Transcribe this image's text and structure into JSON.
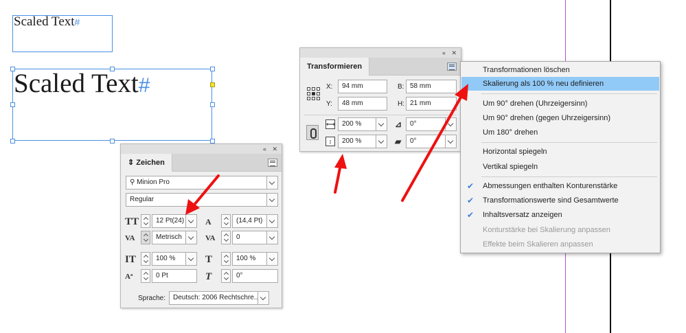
{
  "canvas": {
    "text_small": "Scaled Text",
    "text_large": "Scaled Text",
    "end_marker": "#"
  },
  "zeichen": {
    "tab_label": "Zeichen",
    "font_family": "Minion Pro",
    "font_style": "Regular",
    "font_size": "12 Pt(24)",
    "leading": "(14,4 Pt)",
    "kerning": "Metrisch",
    "tracking": "0",
    "vertical_scale": "100 %",
    "horizontal_scale": "100 %",
    "baseline_shift": "0 Pt",
    "skew": "0°",
    "language_label": "Sprache:",
    "language": "Deutsch: 2006 Rechtschre..."
  },
  "transformieren": {
    "tab_label": "Transformieren",
    "x_label": "X:",
    "x_value": "94 mm",
    "y_label": "Y:",
    "y_value": "48 mm",
    "b_label": "B:",
    "b_value": "58 mm",
    "h_label": "H:",
    "h_value": "21 mm",
    "scale_x": "200 %",
    "scale_y": "200 %",
    "rotation": "0°",
    "shear": "0°"
  },
  "context_menu": {
    "items": [
      {
        "label": "Transformationen löschen",
        "checked": false,
        "disabled": false,
        "highlight": false
      },
      {
        "label": "Skalierung als 100 % neu definieren",
        "checked": false,
        "disabled": false,
        "highlight": true
      },
      {
        "label": "Um 90° drehen (Uhrzeigersinn)",
        "checked": false,
        "disabled": false,
        "highlight": false
      },
      {
        "label": "Um 90° drehen (gegen Uhrzeigersinn)",
        "checked": false,
        "disabled": false,
        "highlight": false
      },
      {
        "label": "Um 180° drehen",
        "checked": false,
        "disabled": false,
        "highlight": false
      },
      {
        "label": "Horizontal spiegeln",
        "checked": false,
        "disabled": false,
        "highlight": false
      },
      {
        "label": "Vertikal spiegeln",
        "checked": false,
        "disabled": false,
        "highlight": false
      },
      {
        "label": "Abmessungen enthalten Konturenstärke",
        "checked": true,
        "disabled": false,
        "highlight": false
      },
      {
        "label": "Transformationswerte sind Gesamtwerte",
        "checked": true,
        "disabled": false,
        "highlight": false
      },
      {
        "label": "Inhaltsversatz anzeigen",
        "checked": true,
        "disabled": false,
        "highlight": false
      },
      {
        "label": "Konturstärke bei Skalierung anpassen",
        "checked": false,
        "disabled": true,
        "highlight": false
      },
      {
        "label": "Effekte beim Skalieren anpassen",
        "checked": false,
        "disabled": true,
        "highlight": false
      }
    ]
  },
  "icons": {
    "collapse": "«",
    "close": "✕",
    "check": "✔",
    "font_size_glyph": "TT",
    "leading_glyph": "A",
    "kerning_glyph": "VA",
    "tracking_glyph": "VA",
    "vscale_glyph": "IT",
    "hscale_glyph": "T",
    "baseline_glyph": "Aª",
    "skew_glyph": "T",
    "angle_glyph": "⊿",
    "shear_glyph": "▰"
  },
  "colors": {
    "highlight": "#91c9f7",
    "annotation_arrow": "#ee1111",
    "selection": "#4a90e2",
    "check": "#3d7fd6"
  }
}
